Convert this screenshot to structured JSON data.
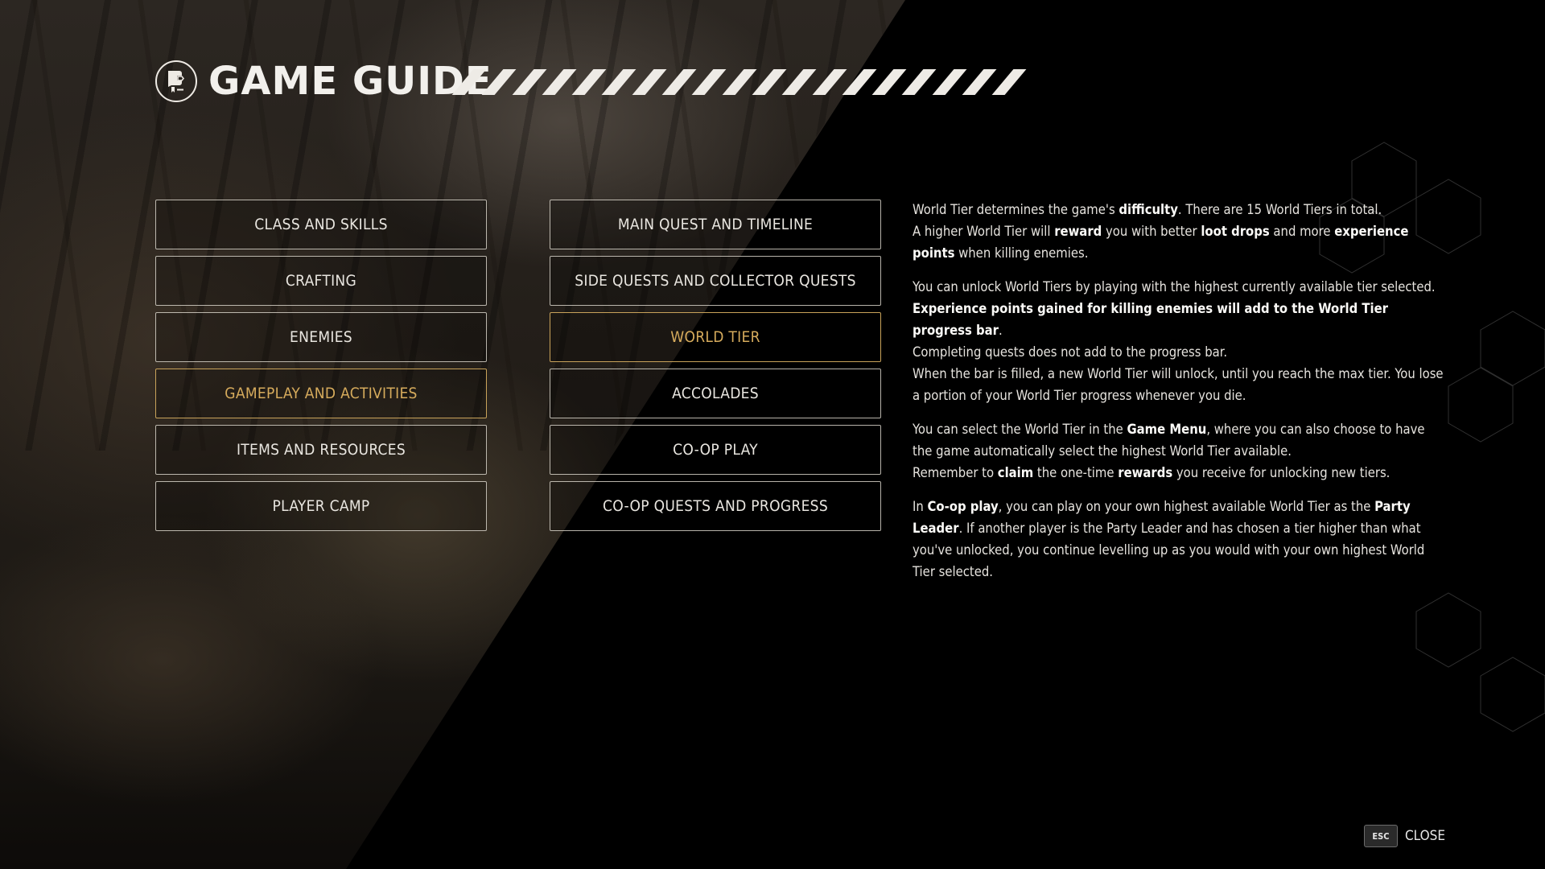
{
  "header": {
    "title": "GAME GUIDE",
    "icon": "guide-book-icon",
    "slash_count": 19
  },
  "colors": {
    "accent": "#d6ab5c",
    "text": "#e9e6e0",
    "border": "#d7d2c8"
  },
  "categories_left": [
    {
      "label": "CLASS AND SKILLS",
      "active": false
    },
    {
      "label": "CRAFTING",
      "active": false
    },
    {
      "label": "ENEMIES",
      "active": false
    },
    {
      "label": "GAMEPLAY AND ACTIVITIES",
      "active": true
    },
    {
      "label": "ITEMS AND RESOURCES",
      "active": false
    },
    {
      "label": "PLAYER CAMP",
      "active": false
    }
  ],
  "categories_right": [
    {
      "label": "MAIN QUEST AND TIMELINE",
      "active": false
    },
    {
      "label": "SIDE QUESTS AND COLLECTOR QUESTS",
      "active": false
    },
    {
      "label": "WORLD TIER",
      "active": true
    },
    {
      "label": "ACCOLADES",
      "active": false
    },
    {
      "label": "CO-OP PLAY",
      "active": false
    },
    {
      "label": "CO-OP QUESTS AND PROGRESS",
      "active": false
    }
  ],
  "content": {
    "paragraphs": [
      [
        [
          {
            "t": "World Tier determines the game's "
          },
          {
            "t": "difficulty",
            "b": true
          },
          {
            "t": ". There are 15 World Tiers in total."
          }
        ],
        [
          {
            "t": "A higher World Tier will "
          },
          {
            "t": "reward",
            "b": true
          },
          {
            "t": " you with better "
          },
          {
            "t": "loot drops",
            "b": true
          },
          {
            "t": " and more "
          },
          {
            "t": "experience points",
            "b": true
          },
          {
            "t": " when killing enemies."
          }
        ]
      ],
      [
        [
          {
            "t": "You can unlock World Tiers by playing with the highest currently available tier selected."
          }
        ],
        [
          {
            "t": "Experience points gained for killing enemies will add to the World Tier progress bar",
            "b": true
          },
          {
            "t": "."
          }
        ],
        [
          {
            "t": "Completing quests does not add to the progress bar."
          }
        ],
        [
          {
            "t": "When the bar is filled, a new World Tier will unlock, until you reach the max tier. You lose a portion of your World Tier progress whenever you die."
          }
        ]
      ],
      [
        [
          {
            "t": "You can select the World Tier in the "
          },
          {
            "t": "Game Menu",
            "b": true
          },
          {
            "t": ", where you can also choose to have the game automatically select the highest World Tier available."
          }
        ],
        [
          {
            "t": "Remember to "
          },
          {
            "t": "claim",
            "b": true
          },
          {
            "t": " the one-time "
          },
          {
            "t": "rewards",
            "b": true
          },
          {
            "t": " you receive for unlocking new tiers."
          }
        ]
      ],
      [
        [
          {
            "t": "In "
          },
          {
            "t": "Co-op play",
            "b": true
          },
          {
            "t": ", you can play on your own highest available World Tier as the "
          },
          {
            "t": "Party Leader",
            "b": true
          },
          {
            "t": ". If another player is the Party Leader and has chosen a tier higher than what you've unlocked, you continue levelling up as you would with your own highest World Tier selected."
          }
        ]
      ]
    ]
  },
  "footer": {
    "key_label": "ESC",
    "close_label": "CLOSE"
  }
}
